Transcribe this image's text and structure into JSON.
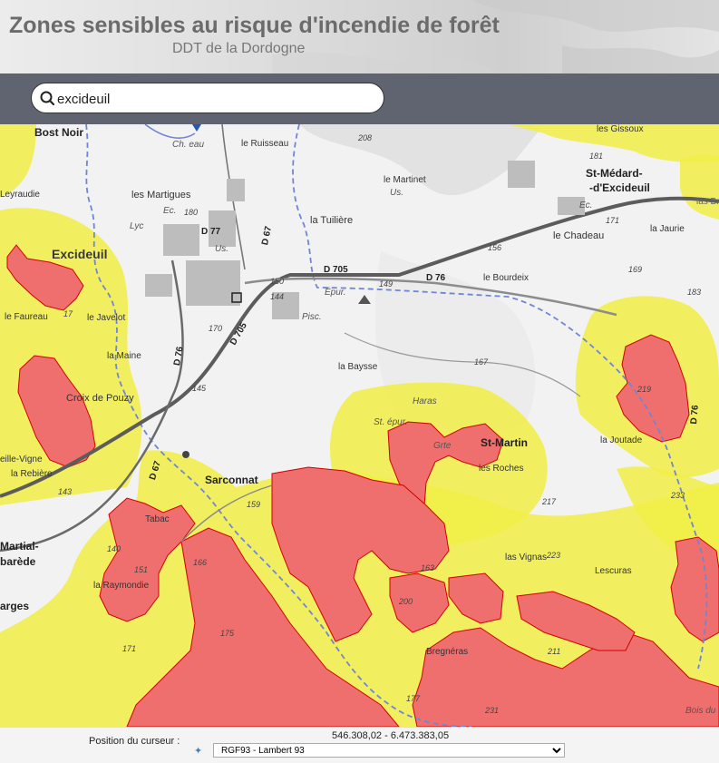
{
  "header": {
    "title": "Zones sensibles au risque d'incendie de forêt",
    "subtitle": "DDT de la Dordogne"
  },
  "search": {
    "value": "excideuil",
    "icon": "search-icon"
  },
  "map": {
    "labels": {
      "bost_noir": "Bost Noir",
      "ch_eau": "Ch. eau",
      "ruisseau": "le Ruisseau",
      "n208": "208",
      "gissoux": "les Gissoux",
      "n181": "181",
      "st_medard_1": "St-Médard-",
      "st_medard_2": "-d'Excideuil",
      "la_br": "las Bra",
      "leyraudie": "Leyraudie",
      "les_martigues": "les Martigues",
      "ec1": "Ec.",
      "n180": "180",
      "lyc": "Lyc",
      "d77": "D 77",
      "le_martinet": "le Martinet",
      "us1": "Us.",
      "la_tuiliere": "la Tuilière",
      "ec2": "Ec.",
      "n171": "171",
      "le_chadeau": "le Chadeau",
      "la_jaurie": "la Jaurie",
      "excideuil": "Excideuil",
      "us2": "Us.",
      "d67a": "D 67",
      "d705a": "D 705",
      "n156": "156",
      "n169": "169",
      "n183": "183",
      "n150": "150",
      "le_bourdeix": "le Bourdeix",
      "d76a": "D 76",
      "n149": "149",
      "n144": "144",
      "epur1": "Épur.",
      "le_faureau": "le Faureau",
      "le_javelot": "le Javelot",
      "n17": "17",
      "pisc": "Pisc.",
      "n170": "170",
      "d705b": "D 705",
      "la_maine": "la Maine",
      "d76b": "D 76",
      "n167": "167",
      "la_baysse": "la Baysse",
      "n219": "219",
      "croix_pouzy": "Croix de Pouzy",
      "n145": "145",
      "haras": "Haras",
      "epur2": "St. épur.",
      "grte": "Grte",
      "st_martin": "St-Martin",
      "la_joutade": "la Joutade",
      "vieille_vigne": "eille-Vigne",
      "la_rebiere": "la Rebière",
      "d67b": "D 67",
      "les_roches": "les Roches",
      "sarconnat": "Sarconnat",
      "n159": "159",
      "n143": "143",
      "n217": "217",
      "n233": "233",
      "tabac": "Tabac",
      "martial_1": "Martial-",
      "martial_2": "barède",
      "n140": "140",
      "n151": "151",
      "n166": "166",
      "n223": "223",
      "les_vignas": "las Vignas",
      "lescuras": "Lescuras",
      "la_raymondie": "la Raymondie",
      "n200": "200",
      "arges": "arges",
      "n175": "175",
      "n171b": "171",
      "bregneras": "Bregnéras",
      "n211": "211",
      "n177": "177",
      "n231": "231",
      "bois_du": "Bois du",
      "n163": "163",
      "d76c": "D 76"
    }
  },
  "footer": {
    "position_label": "Position du curseur :",
    "coordinates": "546.308,02 - 6.473.383,05",
    "projection": "RGF93 - Lambert 93",
    "projection_icon": "projection-icon"
  }
}
